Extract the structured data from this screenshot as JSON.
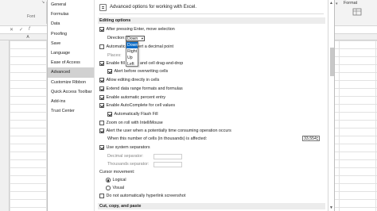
{
  "excel": {
    "ribbon_group_label": "Font",
    "format_label": "Format",
    "column_a": "A"
  },
  "nav": {
    "items": [
      {
        "label": "General",
        "active": false
      },
      {
        "label": "Formulas",
        "active": false
      },
      {
        "label": "Data",
        "active": false
      },
      {
        "label": "Proofing",
        "active": false
      },
      {
        "label": "Save",
        "active": false
      },
      {
        "label": "Language",
        "active": false
      },
      {
        "label": "Ease of Access",
        "active": false
      },
      {
        "label": "Advanced",
        "active": true
      },
      {
        "label": "Customize Ribbon",
        "active": false
      },
      {
        "label": "Quick Access Toolbar",
        "active": false
      },
      {
        "label": "Add-ins",
        "active": false
      },
      {
        "label": "Trust Center",
        "active": false
      }
    ]
  },
  "main": {
    "header": "Advanced options for working with Excel.",
    "sections": {
      "editing": "Editing options",
      "cut_copy": "Cut, copy, and paste"
    },
    "editing": {
      "after_enter": {
        "label": "After pressing Enter, move selection",
        "checked": true
      },
      "direction_label": "Direction:",
      "direction_value": "Down",
      "direction_options": [
        "Down",
        "Right",
        "Up",
        "Left"
      ],
      "auto_decimal": {
        "label": "Automatically insert a decimal point",
        "checked": false
      },
      "places_label": "Places:",
      "fill_handle": {
        "label": "Enable fill handle and cell drag-and-drop",
        "checked": true
      },
      "alert_overwrite": {
        "label": "Alert before overwriting cells",
        "checked": true
      },
      "allow_edit": {
        "label": "Allow editing directly in cells",
        "checked": true
      },
      "extend_formats": {
        "label": "Extend data range formats and formulas",
        "checked": true
      },
      "auto_percent": {
        "label": "Enable automatic percent entry",
        "checked": true
      },
      "autocomplete": {
        "label": "Enable AutoComplete for cell values",
        "checked": true
      },
      "flash_fill": {
        "label": "Automatically Flash Fill",
        "checked": true
      },
      "zoom_roll": {
        "label": "Zoom on roll with IntelliMouse",
        "checked": false
      },
      "alert_time": {
        "label": "Alert the user when a potentially time consuming operation occurs",
        "checked": true
      },
      "cells_affected_label": "When this number of cells (in thousands) is affected:",
      "cells_affected_value": "33,554",
      "system_separators": {
        "label": "Use system separators",
        "checked": true
      },
      "decimal_separator_label": "Decimal separator:",
      "thousands_separator_label": "Thousands separator:",
      "cursor_movement_label": "Cursor movement:",
      "cursor_logical": {
        "label": "Logical",
        "selected": true
      },
      "cursor_visual": {
        "label": "Visual",
        "selected": false
      },
      "no_hyperlink_screenshot": {
        "label": "Do not automatically hyperlink screenshot",
        "checked": false
      }
    }
  }
}
